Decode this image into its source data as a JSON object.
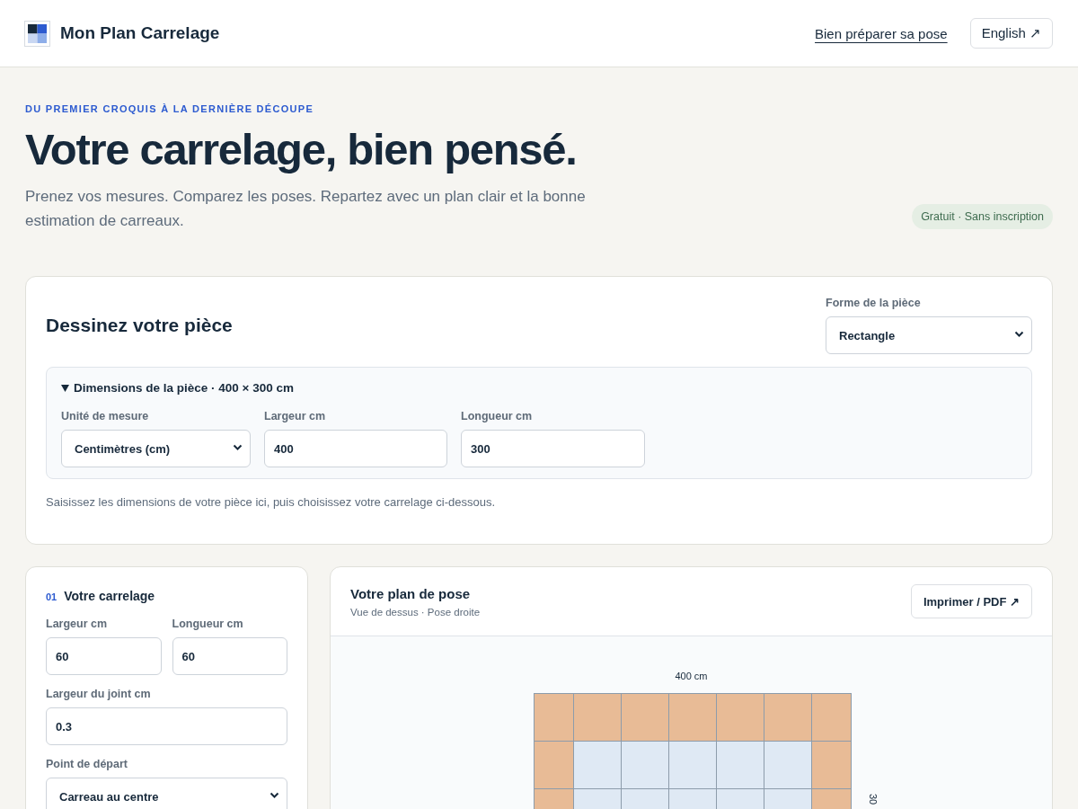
{
  "header": {
    "brand": "Mon Plan Carrelage",
    "guide_link": "Bien préparer sa pose",
    "language_button": "English ↗"
  },
  "hero": {
    "eyebrow": "DU PREMIER CROQUIS À LA DERNIÈRE DÉCOUPE",
    "title": "Votre carrelage, bien pensé.",
    "subtitle": "Prenez vos mesures. Comparez les poses. Repartez avec un plan clair et la bonne estimation de carreaux.",
    "badge": "Gratuit · Sans inscription"
  },
  "room_card": {
    "title": "Dessinez votre pièce",
    "shape": {
      "label": "Forme de la pièce",
      "value": "Rectangle"
    },
    "dimensions": {
      "summary": "Dimensions de la pièce · 400 × 300 cm",
      "expanded": true,
      "fields": [
        {
          "kind": "select",
          "label": "Unité de mesure",
          "value": "Centimètres (cm)"
        },
        {
          "kind": "input",
          "label": "Largeur cm",
          "value": "400"
        },
        {
          "kind": "input",
          "label": "Longueur cm",
          "value": "300"
        }
      ]
    },
    "note": "Saisissez les dimensions de votre pièce ici, puis choisissez votre carrelage ci-dessous."
  },
  "tile_card": {
    "step": "01",
    "title": "Votre carrelage",
    "size_fields": [
      {
        "kind": "input",
        "label": "Largeur cm",
        "value": "60"
      },
      {
        "kind": "input",
        "label": "Longueur cm",
        "value": "60"
      }
    ],
    "joint_field": {
      "kind": "input",
      "label": "Largeur du joint cm",
      "value": "0.3"
    },
    "start_field": {
      "kind": "select",
      "label": "Point de départ",
      "value": "Carreau au centre"
    }
  },
  "plan_card": {
    "title": "Votre plan de pose",
    "subtitle": "Vue de dessus · Pose droite",
    "print_button": "Imprimer / PDF ↗",
    "width_label": "400 cm",
    "height_label": "30",
    "rows": [
      {
        "tiles": [
          {
            "kind": "edge"
          },
          {
            "kind": "edge"
          },
          {
            "kind": "edge"
          },
          {
            "kind": "edge"
          },
          {
            "kind": "edge"
          },
          {
            "kind": "edge"
          },
          {
            "kind": "edge"
          }
        ]
      },
      {
        "tiles": [
          {
            "kind": "edge"
          },
          {
            "kind": "inner"
          },
          {
            "kind": "inner"
          },
          {
            "kind": "inner"
          },
          {
            "kind": "inner"
          },
          {
            "kind": "inner"
          },
          {
            "kind": "edge"
          }
        ]
      },
      {
        "tiles": [
          {
            "kind": "edge"
          },
          {
            "kind": "inner"
          },
          {
            "kind": "inner"
          },
          {
            "kind": "inner"
          },
          {
            "kind": "inner"
          },
          {
            "kind": "inner"
          },
          {
            "kind": "edge"
          }
        ]
      }
    ]
  }
}
